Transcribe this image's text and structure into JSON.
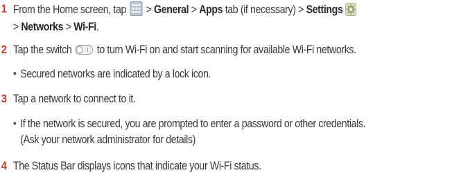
{
  "steps": [
    {
      "number": "1",
      "line1": {
        "t1": "From the Home screen, tap ",
        "t2": " > ",
        "b1": "General",
        "t3": " > ",
        "b2": "Apps",
        "t4": " tab (if necessary) > ",
        "b3": "Settings"
      },
      "line2": {
        "t1": "> ",
        "b1": "Networks",
        "t2": " > ",
        "b2": "Wi-Fi",
        "t3": "."
      },
      "icons": [
        "apps-grid-icon",
        "settings-gear-icon"
      ]
    },
    {
      "number": "2",
      "t1": "Tap the switch ",
      "t2": " to turn Wi-Fi on and start scanning for available Wi-Fi networks.",
      "bullet": "Secured networks are indicated by a lock icon.",
      "icons": [
        "toggle-switch-icon"
      ]
    },
    {
      "number": "3",
      "text": "Tap a network to connect to it.",
      "bullet_line1": "If the network is secured, you are prompted to enter a password or other credentials.",
      "bullet_line2": "(Ask your network administrator for details)"
    },
    {
      "number": "4",
      "text": "The Status Bar displays icons that indicate your Wi-Fi status."
    }
  ],
  "bullet_symbol": "•",
  "colors": {
    "step_number": "#c0392b",
    "text": "#3a3a3a"
  }
}
